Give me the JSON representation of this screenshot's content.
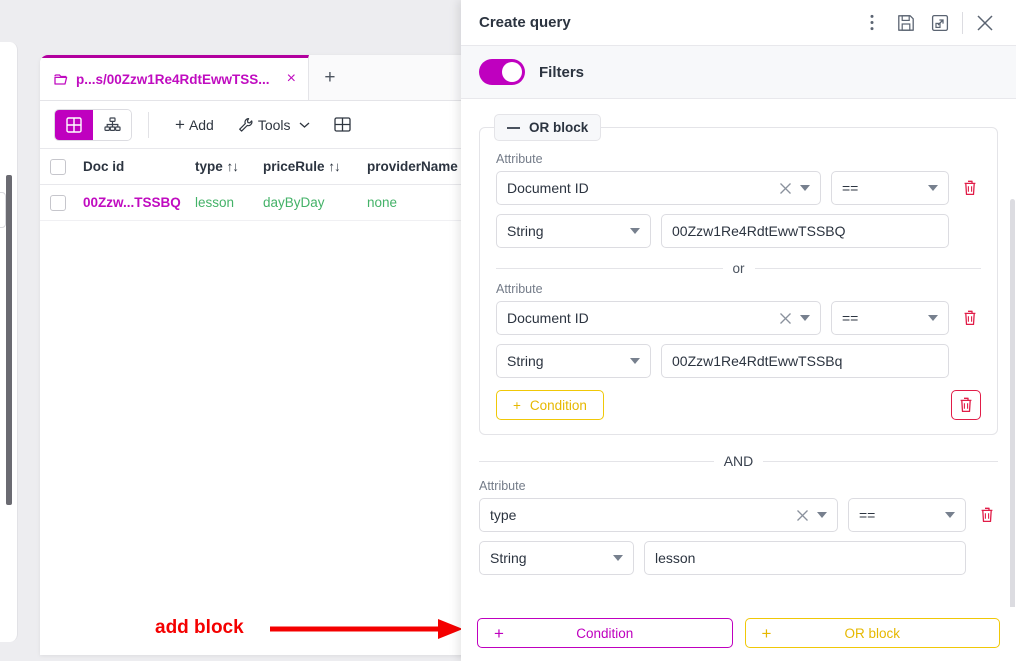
{
  "left_app": {
    "tab": {
      "folder_icon": "folder-icon",
      "label": "p...s/00Zzw1Re4RdtEwwTSS...",
      "close_icon": "×",
      "add_tab_icon": "+"
    },
    "toolbar": {
      "view_grid_icon": "grid-view-icon",
      "view_tree_icon": "tree-view-icon",
      "add_label": "Add",
      "add_icon": "+",
      "tools_label": "Tools",
      "tools_icon": "wrench-icon",
      "tools_chevron": "chevron-down-icon",
      "columns_icon": "columns-icon"
    },
    "table": {
      "columns": [
        {
          "label": "Doc id",
          "sortable": false,
          "sort_icon": ""
        },
        {
          "label": "type",
          "sortable": true,
          "sort_icon": "↑↓"
        },
        {
          "label": "priceRule",
          "sortable": true,
          "sort_icon": "↑↓"
        },
        {
          "label": "providerName",
          "sortable": false,
          "sort_icon": ""
        }
      ],
      "rows": [
        {
          "doc_id": "00Zzw...TSSBQ",
          "type": "lesson",
          "priceRule": "dayByDay",
          "providerName": "none"
        }
      ]
    }
  },
  "annotation": {
    "text": "add block",
    "color": "#f40000",
    "arrow": "right-arrow"
  },
  "panel": {
    "title": "Create query",
    "header_icons": [
      {
        "name": "more-options-icon",
        "glyph": "⋮"
      },
      {
        "name": "save-icon",
        "glyph": "save"
      },
      {
        "name": "expand-icon",
        "glyph": "expand"
      },
      {
        "name": "close-icon",
        "glyph": "×"
      }
    ],
    "filters": {
      "label": "Filters",
      "enabled": true,
      "accent": "#bf00bf"
    },
    "or_block": {
      "label": "OR block",
      "collapse_icon": "minus-icon",
      "conditions": [
        {
          "attribute_label": "Attribute",
          "attribute_value": "Document ID",
          "operator": "==",
          "type": "String",
          "value": "00Zzw1Re4RdtEwwTSSBQ",
          "clear_icon": "clear-icon",
          "delete_icon": "trash-icon"
        },
        {
          "attribute_label": "Attribute",
          "attribute_value": "Document ID",
          "operator": "==",
          "type": "String",
          "value": "00Zzw1Re4RdtEwwTSSBq",
          "clear_icon": "clear-icon",
          "delete_icon": "trash-icon"
        }
      ],
      "separator_label": "or",
      "add_condition_label": "Condition",
      "add_condition_icon": "+",
      "delete_block_icon": "trash-icon"
    },
    "and_separator": "AND",
    "and_condition": {
      "attribute_label": "Attribute",
      "attribute_value": "type",
      "operator": "==",
      "type": "String",
      "value": "lesson",
      "clear_icon": "clear-icon",
      "delete_icon": "trash-icon"
    },
    "footer": {
      "add_condition_label": "Condition",
      "add_condition_icon": "+",
      "add_or_block_label": "OR block",
      "add_or_block_icon": "+",
      "condition_color": "#bf00bf",
      "or_block_color": "#f0c808"
    }
  }
}
